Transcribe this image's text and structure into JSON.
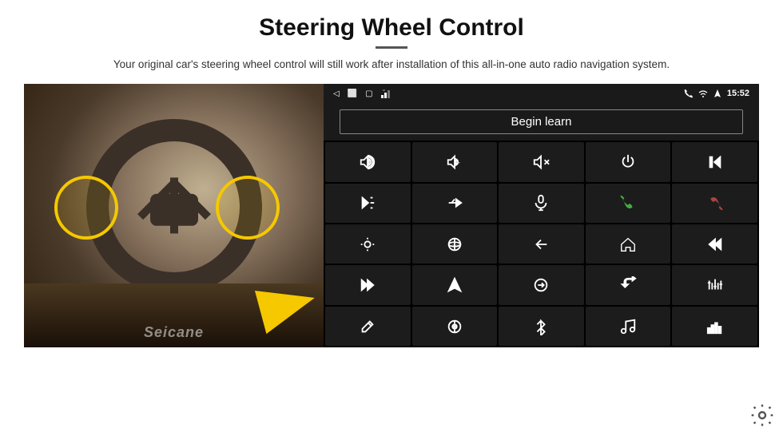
{
  "title": "Steering Wheel Control",
  "subtitle": "Your original car's steering wheel control will still work after installation of this all-in-one auto radio navigation system.",
  "status_bar": {
    "nav_back": "◁",
    "nav_home": "⬜",
    "nav_recent": "▢",
    "signal": "📶",
    "phone": "📞",
    "wifi": "◈",
    "signal2": "▲",
    "time": "15:52"
  },
  "begin_learn_label": "Begin learn",
  "grid_icons": [
    {
      "id": "vol-up",
      "symbol": "vol+",
      "row": 1,
      "col": 1
    },
    {
      "id": "vol-down",
      "symbol": "vol-",
      "row": 1,
      "col": 2
    },
    {
      "id": "vol-mute",
      "symbol": "volx",
      "row": 1,
      "col": 3
    },
    {
      "id": "power",
      "symbol": "pwr",
      "row": 1,
      "col": 4
    },
    {
      "id": "prev-track",
      "symbol": "prev",
      "row": 1,
      "col": 5
    },
    {
      "id": "next-fast",
      "symbol": "nxt",
      "row": 2,
      "col": 1
    },
    {
      "id": "skip-fwd",
      "symbol": "skip",
      "row": 2,
      "col": 2
    },
    {
      "id": "mic",
      "symbol": "mic",
      "row": 2,
      "col": 3
    },
    {
      "id": "phone-ans",
      "symbol": "ans",
      "row": 2,
      "col": 4
    },
    {
      "id": "phone-end",
      "symbol": "end",
      "row": 2,
      "col": 5
    },
    {
      "id": "brightness",
      "symbol": "bri",
      "row": 3,
      "col": 1
    },
    {
      "id": "360-view",
      "symbol": "360",
      "row": 3,
      "col": 2
    },
    {
      "id": "back",
      "symbol": "back",
      "row": 3,
      "col": 3
    },
    {
      "id": "home",
      "symbol": "home",
      "row": 3,
      "col": 4
    },
    {
      "id": "rewind",
      "symbol": "rew",
      "row": 3,
      "col": 5
    },
    {
      "id": "ff",
      "symbol": "ff",
      "row": 4,
      "col": 1
    },
    {
      "id": "nav",
      "symbol": "nav",
      "row": 4,
      "col": 2
    },
    {
      "id": "swap",
      "symbol": "swap",
      "row": 4,
      "col": 3
    },
    {
      "id": "record",
      "symbol": "rec",
      "row": 4,
      "col": 4
    },
    {
      "id": "eq",
      "symbol": "eq",
      "row": 4,
      "col": 5
    },
    {
      "id": "pen",
      "symbol": "pen",
      "row": 5,
      "col": 1
    },
    {
      "id": "target",
      "symbol": "tgt",
      "row": 5,
      "col": 2
    },
    {
      "id": "bluetooth",
      "symbol": "bt",
      "row": 5,
      "col": 3
    },
    {
      "id": "music",
      "symbol": "music",
      "row": 5,
      "col": 4
    },
    {
      "id": "spectrum",
      "symbol": "spec",
      "row": 5,
      "col": 5
    }
  ],
  "watermark": "Seicane",
  "settings_label": "Settings"
}
